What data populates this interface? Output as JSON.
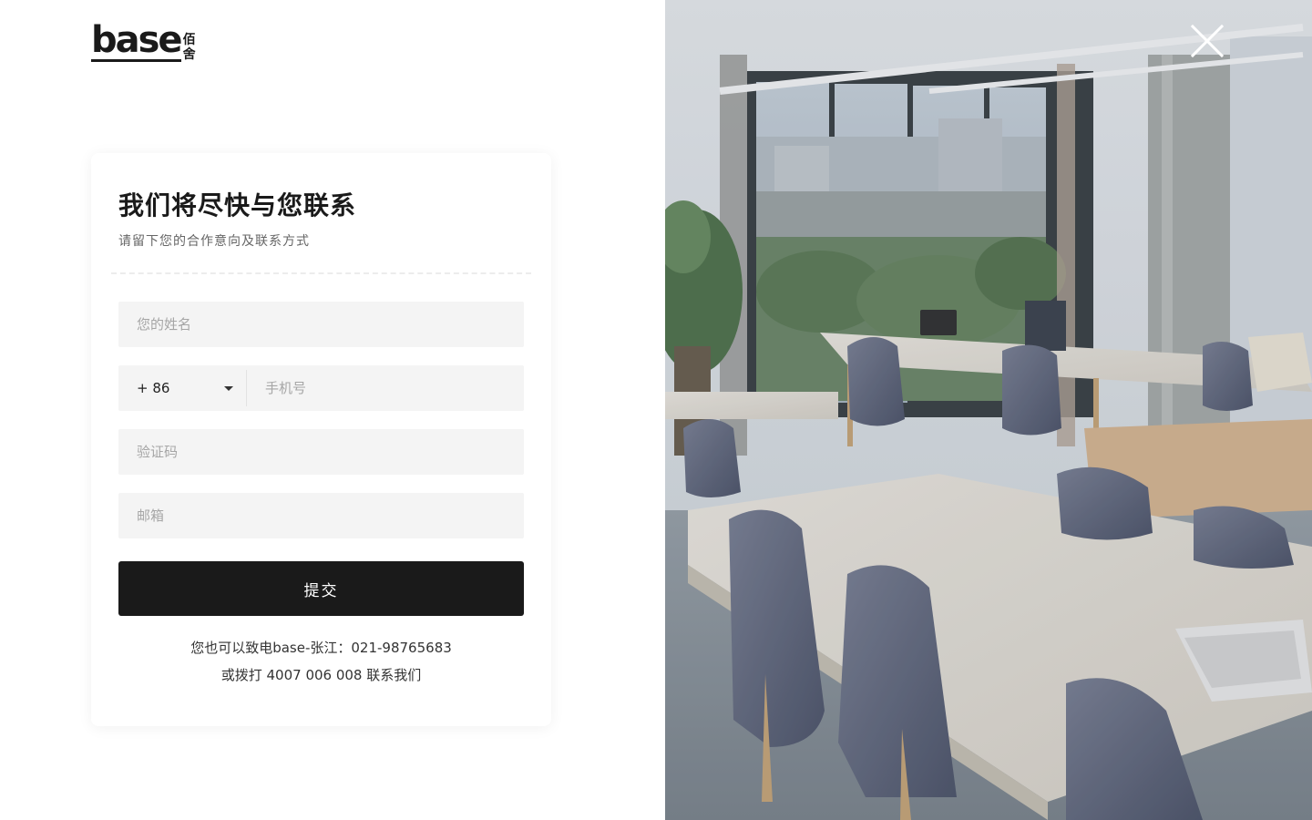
{
  "brand": {
    "logo_word": "base",
    "logo_cn_top": "佰",
    "logo_cn_bottom": "舍"
  },
  "form": {
    "title": "我们将尽快与您联系",
    "subtitle": "请留下您的合作意向及联系方式",
    "name_placeholder": "您的姓名",
    "country_code": "+ 86",
    "phone_placeholder": "手机号",
    "code_placeholder": "验证码",
    "email_placeholder": "邮箱",
    "submit_label": "提交",
    "contact_line_1": "您也可以致电base-张江：021-98765683",
    "contact_line_2": "或拨打 4007 006 008 联系我们"
  },
  "icons": {
    "close": "close-icon",
    "dropdown": "caret-down-icon"
  },
  "colors": {
    "primary": "#1a1a1a",
    "field_bg": "#f4f4f4",
    "placeholder": "#a6a6a6"
  }
}
